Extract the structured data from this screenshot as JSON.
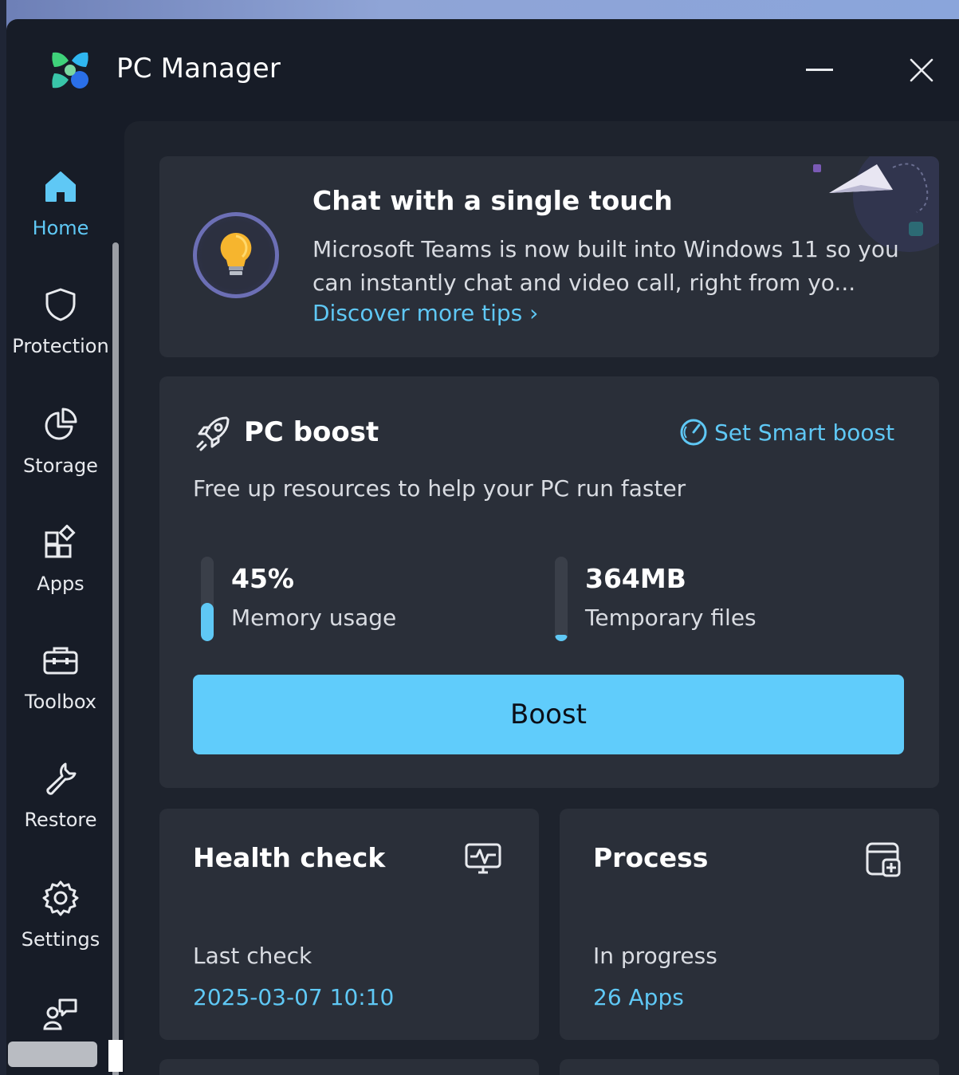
{
  "window": {
    "title": "PC Manager",
    "minimize_icon": "minimize-icon",
    "close_icon": "close-icon"
  },
  "sidebar": {
    "items": [
      {
        "label": "Home",
        "icon": "home-icon",
        "active": true
      },
      {
        "label": "Protection",
        "icon": "shield-icon",
        "active": false
      },
      {
        "label": "Storage",
        "icon": "pie-chart-icon",
        "active": false
      },
      {
        "label": "Apps",
        "icon": "apps-grid-icon",
        "active": false
      },
      {
        "label": "Toolbox",
        "icon": "toolbox-icon",
        "active": false
      },
      {
        "label": "Restore",
        "icon": "wrench-icon",
        "active": false
      },
      {
        "label": "Settings",
        "icon": "gear-icon",
        "active": false
      },
      {
        "label": "",
        "icon": "feedback-icon",
        "active": false
      }
    ]
  },
  "tip": {
    "title": "Chat with a single touch",
    "body": "Microsoft Teams is now built into Windows 11 so you can instantly chat and video call, right from yo...",
    "link": "Discover more tips ›",
    "icon": "lightbulb-icon"
  },
  "boost": {
    "title": "PC boost",
    "smart_link": "Set Smart boost",
    "subtitle": "Free up resources to help your PC run faster",
    "memory": {
      "value": "45%",
      "label": "Memory usage",
      "level": 0.45
    },
    "temp": {
      "value": "364MB",
      "label": "Temporary files",
      "level": 0.08
    },
    "button": "Boost"
  },
  "health": {
    "title": "Health check",
    "sub": "Last check",
    "value": "2025-03-07 10:10",
    "icon": "monitor-pulse-icon"
  },
  "process": {
    "title": "Process",
    "sub": "In progress",
    "value": "26 Apps",
    "icon": "process-window-icon"
  },
  "colors": {
    "accent": "#5fc8f5",
    "button": "#60ccfb",
    "card": "#2a2f39",
    "background": "#1e232d"
  }
}
